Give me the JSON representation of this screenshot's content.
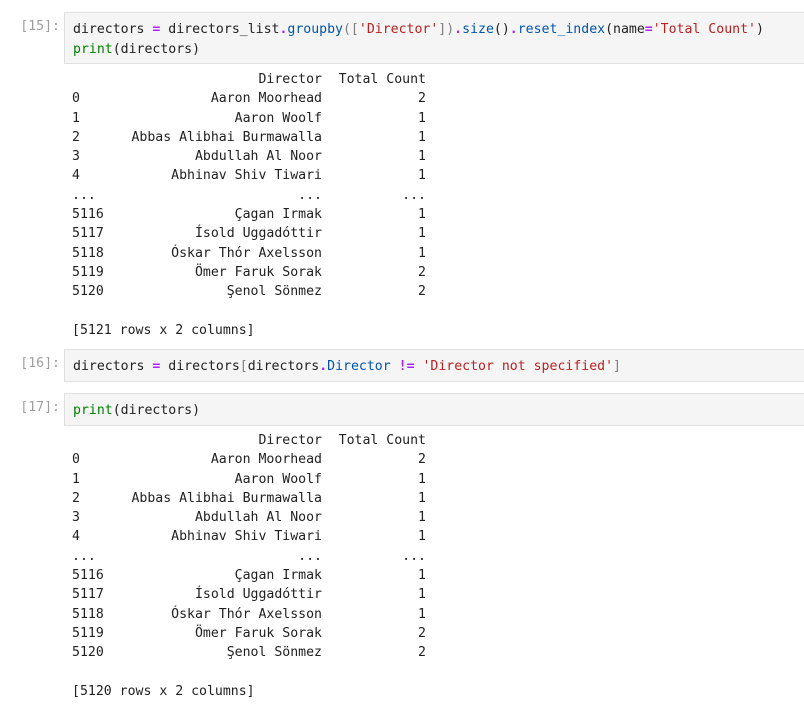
{
  "cells": [
    {
      "prompt": "[15]:",
      "code": [
        [
          {
            "t": "directors ",
            "c": "p"
          },
          {
            "t": "=",
            "c": "o"
          },
          {
            "t": " directors_list",
            "c": "p"
          },
          {
            "t": ".",
            "c": "o"
          },
          {
            "t": "groupby",
            "c": "f"
          },
          {
            "t": "([",
            "c": "b"
          },
          {
            "t": "'Director'",
            "c": "s"
          },
          {
            "t": "])",
            "c": "b"
          },
          {
            "t": ".",
            "c": "o"
          },
          {
            "t": "size",
            "c": "f"
          },
          {
            "t": "()",
            "c": "p"
          },
          {
            "t": ".",
            "c": "o"
          },
          {
            "t": "reset_index",
            "c": "f"
          },
          {
            "t": "(name",
            "c": "p"
          },
          {
            "t": "=",
            "c": "o"
          },
          {
            "t": "'Total Count'",
            "c": "s"
          },
          {
            "t": ")",
            "c": "p"
          }
        ],
        [
          {
            "t": "print",
            "c": "k"
          },
          {
            "t": "(directors)",
            "c": "p"
          }
        ]
      ],
      "output": {
        "header": {
          "index": "",
          "director": "Director",
          "count": "Total Count"
        },
        "rows": [
          {
            "index": "0",
            "director": "Aaron Moorhead",
            "count": "2"
          },
          {
            "index": "1",
            "director": "Aaron Woolf",
            "count": "1"
          },
          {
            "index": "2",
            "director": "Abbas Alibhai Burmawalla",
            "count": "1"
          },
          {
            "index": "3",
            "director": "Abdullah Al Noor",
            "count": "1"
          },
          {
            "index": "4",
            "director": "Abhinav Shiv Tiwari",
            "count": "1"
          },
          {
            "index": "...",
            "director": "...",
            "count": "..."
          },
          {
            "index": "5116",
            "director": "Çagan Irmak",
            "count": "1"
          },
          {
            "index": "5117",
            "director": "Ísold Uggadóttir",
            "count": "1"
          },
          {
            "index": "5118",
            "director": "Óskar Thór Axelsson",
            "count": "1"
          },
          {
            "index": "5119",
            "director": "Ömer Faruk Sorak",
            "count": "2"
          },
          {
            "index": "5120",
            "director": "Şenol Sönmez",
            "count": "2"
          }
        ],
        "summary": "[5121 rows x 2 columns]"
      }
    },
    {
      "prompt": "[16]:",
      "code": [
        [
          {
            "t": "directors ",
            "c": "p"
          },
          {
            "t": "=",
            "c": "o"
          },
          {
            "t": " directors",
            "c": "p"
          },
          {
            "t": "[",
            "c": "b"
          },
          {
            "t": "directors",
            "c": "p"
          },
          {
            "t": ".",
            "c": "o"
          },
          {
            "t": "Director",
            "c": "f"
          },
          {
            "t": " ",
            "c": "p"
          },
          {
            "t": "!=",
            "c": "o"
          },
          {
            "t": " ",
            "c": "p"
          },
          {
            "t": "'Director not specified'",
            "c": "s"
          },
          {
            "t": "]",
            "c": "b"
          }
        ]
      ]
    },
    {
      "prompt": "[17]:",
      "code": [
        [
          {
            "t": "print",
            "c": "k"
          },
          {
            "t": "(directors)",
            "c": "p"
          }
        ]
      ],
      "output": {
        "header": {
          "index": "",
          "director": "Director",
          "count": "Total Count"
        },
        "rows": [
          {
            "index": "0",
            "director": "Aaron Moorhead",
            "count": "2"
          },
          {
            "index": "1",
            "director": "Aaron Woolf",
            "count": "1"
          },
          {
            "index": "2",
            "director": "Abbas Alibhai Burmawalla",
            "count": "1"
          },
          {
            "index": "3",
            "director": "Abdullah Al Noor",
            "count": "1"
          },
          {
            "index": "4",
            "director": "Abhinav Shiv Tiwari",
            "count": "1"
          },
          {
            "index": "...",
            "director": "...",
            "count": "..."
          },
          {
            "index": "5116",
            "director": "Çagan Irmak",
            "count": "1"
          },
          {
            "index": "5117",
            "director": "Ísold Uggadóttir",
            "count": "1"
          },
          {
            "index": "5118",
            "director": "Óskar Thór Axelsson",
            "count": "1"
          },
          {
            "index": "5119",
            "director": "Ömer Faruk Sorak",
            "count": "2"
          },
          {
            "index": "5120",
            "director": "Şenol Sönmez",
            "count": "2"
          }
        ],
        "summary": "[5120 rows x 2 columns]"
      }
    }
  ]
}
